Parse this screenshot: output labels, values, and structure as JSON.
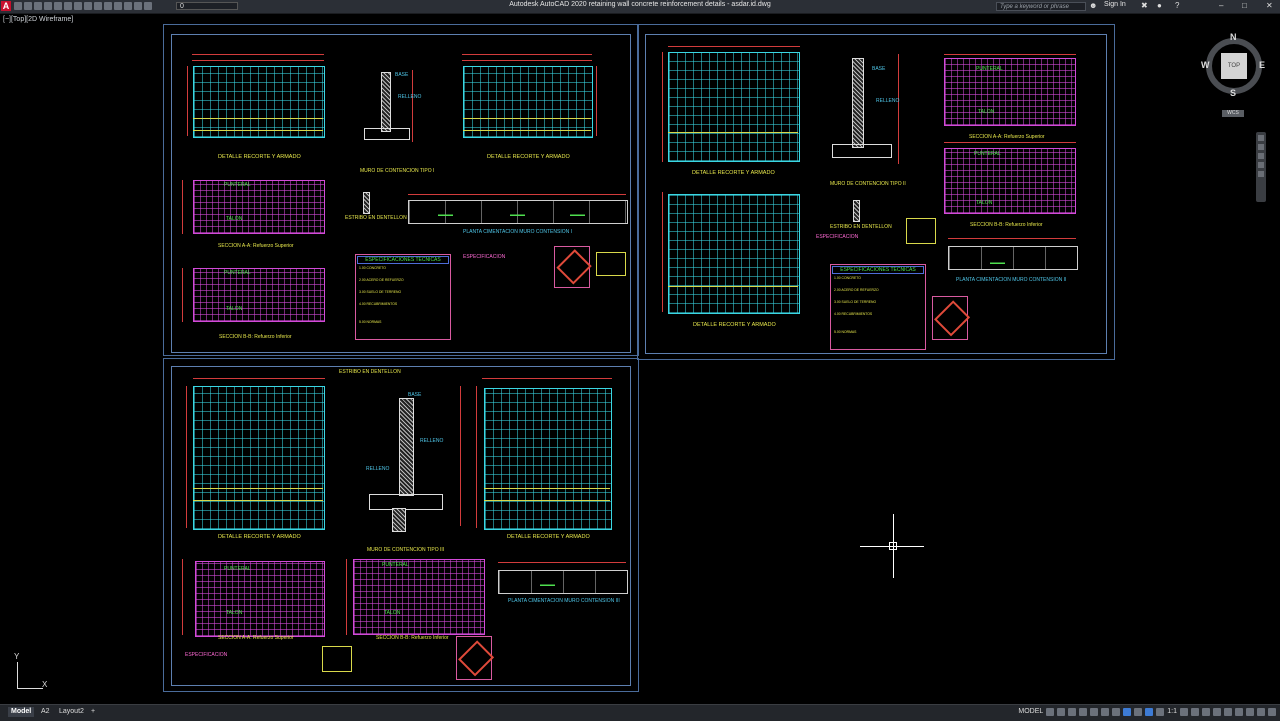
{
  "app": {
    "logo_letter": "A",
    "title": "Autodesk AutoCAD 2020   retaining wall concrete reinforcement details - asdar.id.dwg",
    "layer_value": "0",
    "search_placeholder": "Type a keyword or phrase",
    "signin": "Sign In"
  },
  "viewport": {
    "label": "[−][Top][2D Wireframe]"
  },
  "drawing": {
    "s1": {
      "det_left": "DETALLE RECORTE Y ARMADO",
      "muro": "MURO DE CONTENCION TIPO I",
      "det_right": "DETALLE RECORTE Y ARMADO",
      "sec_a": "SECCION A-A: Refuerzo Superior",
      "sec_b": "SECCION B-B: Refuerzo Inferior",
      "estribo": "ESTRIBO EN DENTELLON",
      "planta": "PLANTA CIMENTACION MURO CONTENSION I",
      "punteral": "PUNTERAL",
      "talon": "TALON",
      "spec_title": "ESPECIFICACIONES TECNICAS",
      "espec": "ESPECIFICACION"
    },
    "s2": {
      "det_top": "DETALLE RECORTE Y ARMADO",
      "muro": "MURO DE CONTENCION TIPO II",
      "det_bottom": "DETALLE RECORTE Y ARMADO",
      "sec_a": "SECCION A-A: Refuerzo Superior",
      "sec_b": "SECCION B-B: Refuerzo Inferior",
      "estribo": "ESTRIBO EN DENTELLON",
      "planta": "PLANTA CIMENTACION MURO CONTENSION II",
      "punteral": "PUNTERAL",
      "talon": "TALON",
      "spec_title": "ESPECIFICACIONES TECNICAS",
      "espec": "ESPECIFICACION"
    },
    "s3": {
      "estribo": "ESTRIBO EN DENTELLON",
      "det_left": "DETALLE RECORTE Y ARMADO",
      "muro": "MURO DE CONTENCION TIPO III",
      "det_right": "DETALLE RECORTE Y ARMADO",
      "sec_a": "SECCION A-A: Refuerzo Superior",
      "sec_b": "SECCION B-B: Refuerzo Inferior",
      "planta": "PLANTA CIMENTACION MURO CONTENSION III",
      "punteral": "PUNTERAL",
      "talon": "TALON",
      "espec": "ESPECIFICACION"
    },
    "spec_lines": [
      "1.00 CONCRETO",
      "2.00 ACERO DE REFUERZO",
      "3.00 SUELO DE TERRENO",
      "4.00 RECUBRIMIENTOS",
      "5.00 NORMAS"
    ]
  },
  "viewcube": {
    "n": "N",
    "s": "S",
    "e": "E",
    "w": "W",
    "top": "TOP",
    "wcs": "WCS"
  },
  "ucs": {
    "x": "X",
    "y": "Y"
  },
  "status": {
    "tab_model": "Model",
    "tab_a2": "A2",
    "tab_layout2": "Layout2",
    "add_tab": "+",
    "model_space": "MODEL",
    "scale": "1:1"
  }
}
